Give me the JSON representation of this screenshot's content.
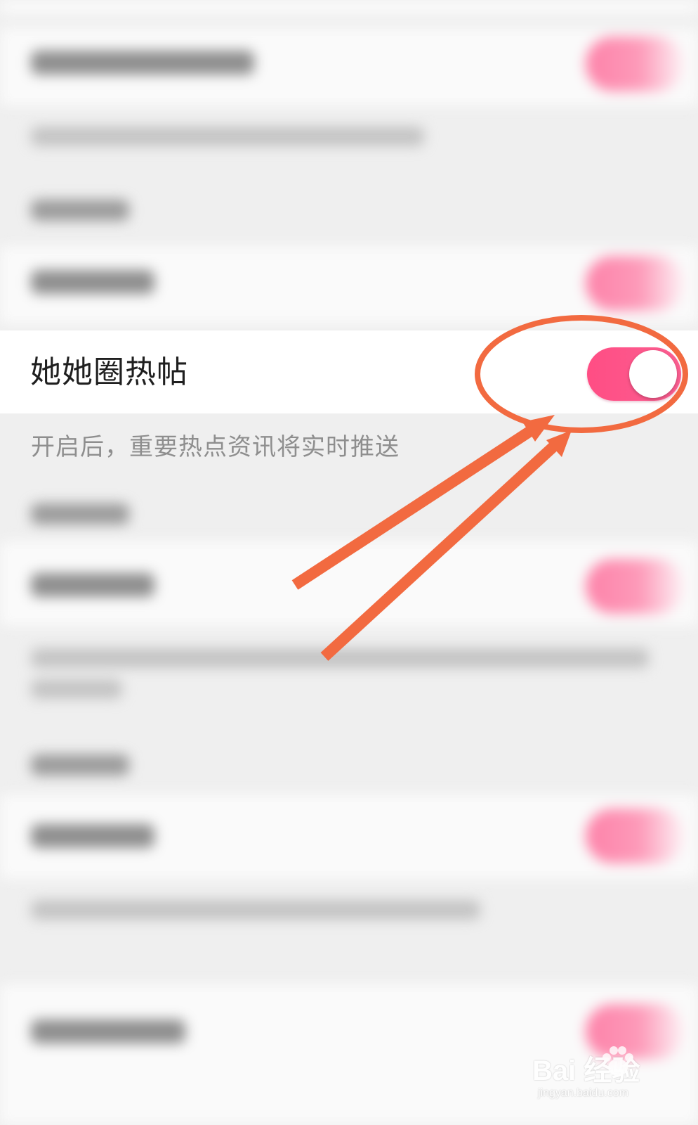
{
  "hot_posts": {
    "title": "她她圈热帖",
    "description": "开启后，重要热点资讯将实时推送",
    "toggle_state": "on"
  },
  "colors": {
    "accent": "#ff4d84",
    "annotation": "#f26a40",
    "background": "#efefef"
  },
  "watermark": {
    "main": "Bai  经验",
    "sub": "jingyan.baidu.com"
  }
}
